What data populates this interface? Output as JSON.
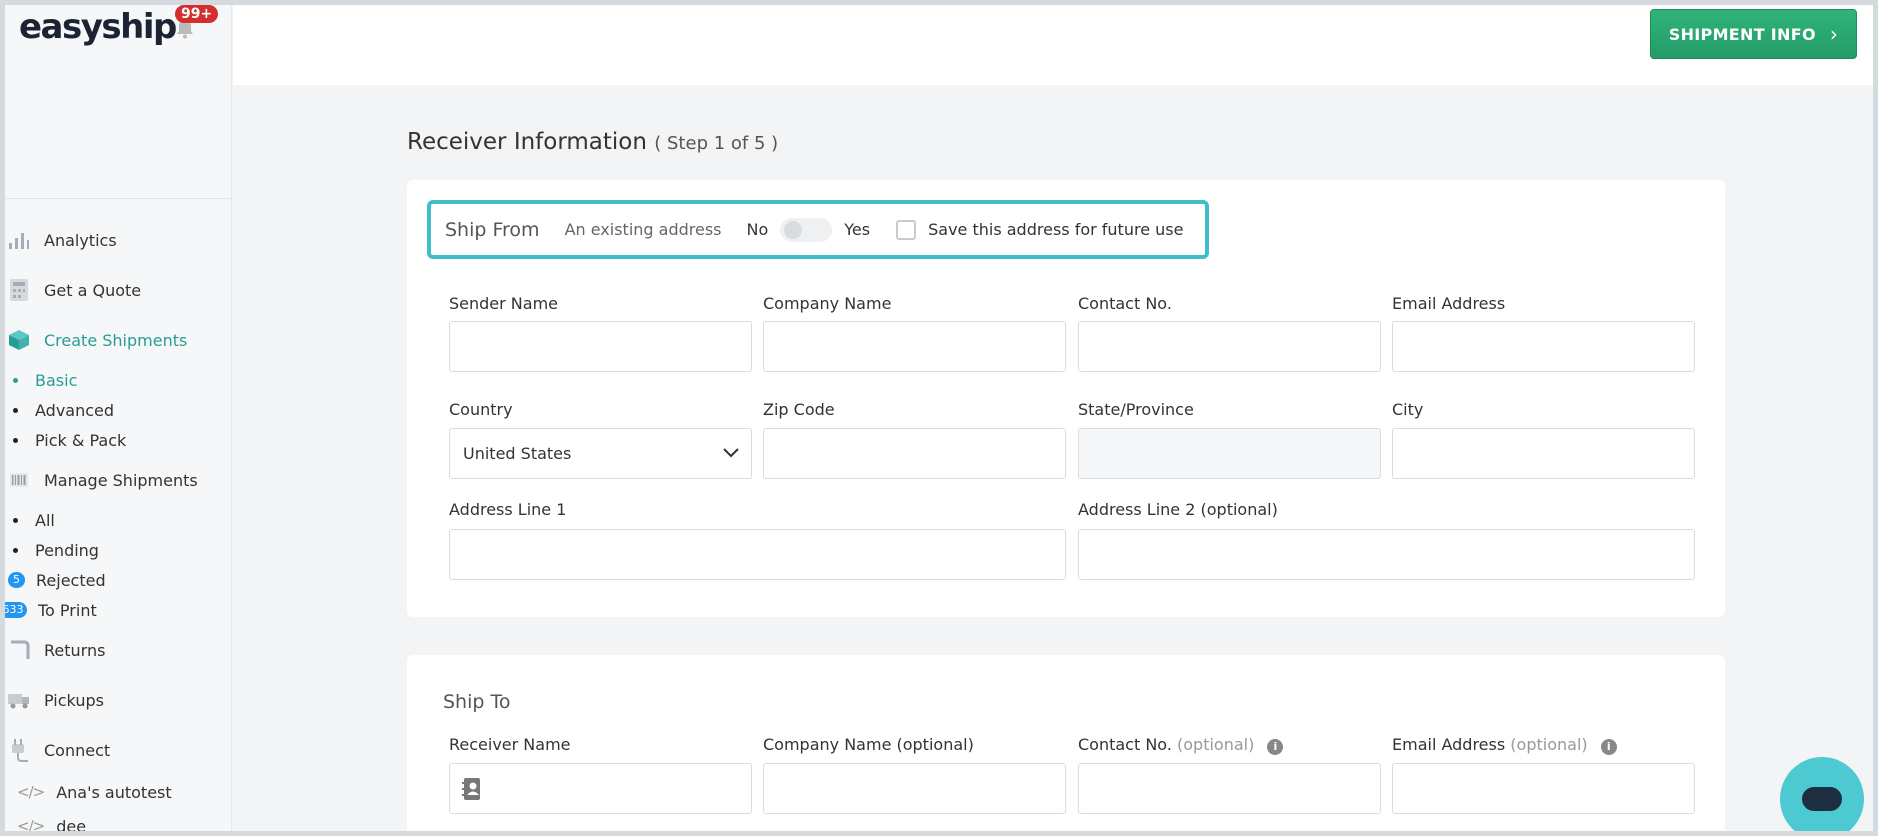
{
  "brand": {
    "logo": "easyship",
    "notification_badge": "99+"
  },
  "header": {
    "shipment_info_label": "SHIPMENT INFO"
  },
  "sidebar": {
    "items": [
      {
        "label": "Analytics",
        "icon": "bar-chart-icon"
      },
      {
        "label": "Get a Quote",
        "icon": "calculator-icon"
      },
      {
        "label": "Create Shipments",
        "icon": "box-icon",
        "active": true
      },
      {
        "label": "Manage Shipments",
        "icon": "barcode-icon"
      },
      {
        "label": "Returns",
        "icon": "returns-icon"
      },
      {
        "label": "Pickups",
        "icon": "truck-icon"
      },
      {
        "label": "Connect",
        "icon": "plug-icon"
      }
    ],
    "create_sub": [
      "Basic",
      "Advanced",
      "Pick & Pack"
    ],
    "manage_sub": [
      {
        "label": "All"
      },
      {
        "label": "Pending"
      },
      {
        "label": "Rejected",
        "count": "5"
      },
      {
        "label": "To Print",
        "count": "633"
      }
    ],
    "dev": [
      "Ana's autotest",
      "dee"
    ]
  },
  "page": {
    "title": "Receiver Information",
    "step": "( Step 1 of 5 )"
  },
  "ship_from": {
    "title": "Ship From",
    "existing_label": "An existing address",
    "toggle_no": "No",
    "toggle_yes": "Yes",
    "save_label": "Save this address for future use",
    "labels": {
      "sender_name": "Sender Name",
      "company_name": "Company Name",
      "contact_no": "Contact No.",
      "email": "Email Address",
      "country": "Country",
      "zip": "Zip Code",
      "state": "State/Province",
      "city": "City",
      "address1": "Address Line 1",
      "address2": "Address Line 2 (optional)"
    },
    "values": {
      "country": "United States"
    }
  },
  "ship_to": {
    "title": "Ship To",
    "labels": {
      "receiver_name": "Receiver Name",
      "company_name": "Company Name (optional)",
      "contact_no": "Contact No.",
      "contact_opt": "(optional)",
      "email": "Email Address",
      "email_opt": "(optional)"
    }
  },
  "colors": {
    "accent": "#2a9c96",
    "button": "#2aa872",
    "highlight_border": "#40bdc9",
    "badge": "#d32f2f"
  }
}
